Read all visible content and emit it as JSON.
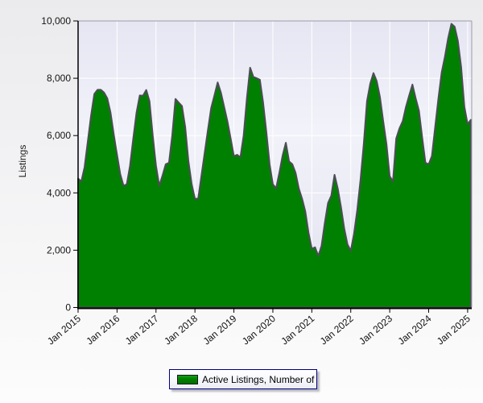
{
  "chart": {
    "y_axis_title": "Listings",
    "legend": {
      "label": "Active Listings, Number of"
    }
  },
  "chart_data": {
    "type": "area",
    "title": "",
    "xlabel": "",
    "ylabel": "Listings",
    "series_name": "Active Listings, Number of",
    "x_frequency": "monthly",
    "x_start": "Jan 2015",
    "x_end": "Feb 2025",
    "x_tick_labels": [
      "Jan 2015",
      "Jan 2016",
      "Jan 2017",
      "Jan 2018",
      "Jan 2019",
      "Jan 2020",
      "Jan 2021",
      "Jan 2022",
      "Jan 2023",
      "Jan 2024",
      "Jan 2025"
    ],
    "y_ticks": [
      0,
      2000,
      4000,
      6000,
      8000,
      10000
    ],
    "y_tick_labels": [
      "0",
      "2,000",
      "4,000",
      "6,000",
      "8,000",
      "10,000"
    ],
    "ylim": [
      0,
      10000
    ],
    "grid": true,
    "legend_position": "bottom-center",
    "colors": {
      "area_fill": "#008000",
      "area_stroke": "#4d4d55",
      "plot_bg_top": "#e6e6f3",
      "plot_bg_mid": "#f2f2fa",
      "plot_bg_bottom": "#e2e2ef",
      "gridline": "#ffffff",
      "axis": "#000000",
      "frame": "#9b9bab",
      "text": "#141414",
      "legend_border": "#000080"
    },
    "values": [
      4500,
      4400,
      4900,
      5800,
      6700,
      7450,
      7600,
      7600,
      7500,
      7300,
      6800,
      6030,
      5330,
      4650,
      4250,
      4300,
      4950,
      5900,
      6800,
      7400,
      7390,
      7590,
      7200,
      6000,
      4950,
      4250,
      4600,
      5000,
      5050,
      6000,
      7280,
      7150,
      7030,
      6300,
      5100,
      4300,
      3790,
      3800,
      4600,
      5400,
      6200,
      6965,
      7400,
      7855,
      7500,
      7000,
      6500,
      5900,
      5280,
      5330,
      5240,
      6000,
      7300,
      8370,
      8050,
      8000,
      7950,
      7150,
      6125,
      5000,
      4300,
      4160,
      4700,
      5300,
      5750,
      5100,
      5000,
      4700,
      4150,
      3800,
      3350,
      2600,
      2050,
      2100,
      1800,
      2150,
      2950,
      3650,
      3900,
      4630,
      4150,
      3500,
      2750,
      2200,
      1980,
      2570,
      3400,
      4450,
      5700,
      7200,
      7810,
      8180,
      7900,
      7340,
      6500,
      5700,
      4580,
      4400,
      5900,
      6250,
      6500,
      7000,
      7400,
      7780,
      7300,
      6870,
      5940,
      5050,
      5000,
      5285,
      6300,
      7300,
      8200,
      8750,
      9400,
      9900,
      9800,
      9300,
      8400,
      7000,
      6400,
      6550
    ]
  }
}
